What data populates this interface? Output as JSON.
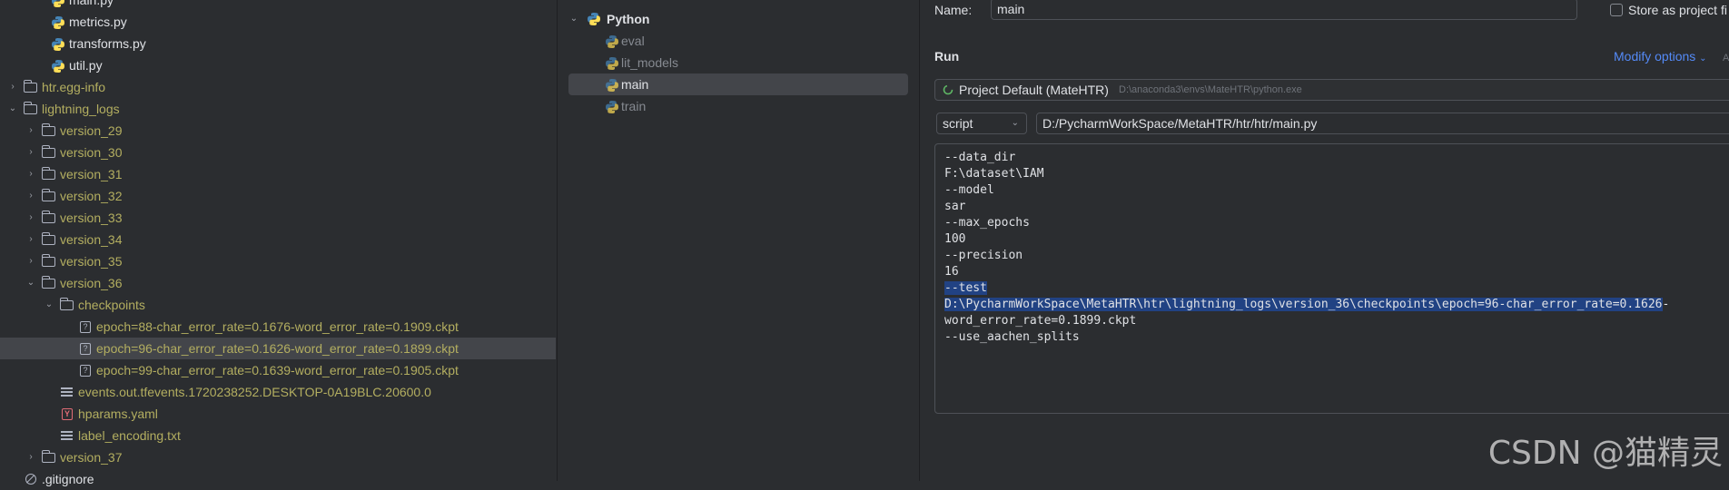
{
  "project_tree": {
    "rows": [
      {
        "label": "main.py",
        "icon": "python-icon",
        "color": "muted"
      },
      {
        "label": "metrics.py",
        "icon": "python-icon",
        "color": "muted"
      },
      {
        "label": "transforms.py",
        "icon": "python-icon",
        "color": "muted"
      },
      {
        "label": "util.py",
        "icon": "python-icon",
        "color": "muted"
      },
      {
        "label": "htr.egg-info",
        "icon": "folder-icon",
        "color": "green",
        "expandable": "collapsed"
      },
      {
        "label": "lightning_logs",
        "icon": "folder-icon",
        "color": "green",
        "expandable": "expanded"
      },
      {
        "label": "version_29",
        "icon": "folder-icon",
        "color": "green",
        "expandable": "collapsed"
      },
      {
        "label": "version_30",
        "icon": "folder-icon",
        "color": "green",
        "expandable": "collapsed"
      },
      {
        "label": "version_31",
        "icon": "folder-icon",
        "color": "green",
        "expandable": "collapsed"
      },
      {
        "label": "version_32",
        "icon": "folder-icon",
        "color": "green",
        "expandable": "collapsed"
      },
      {
        "label": "version_33",
        "icon": "folder-icon",
        "color": "green",
        "expandable": "collapsed"
      },
      {
        "label": "version_34",
        "icon": "folder-icon",
        "color": "green",
        "expandable": "collapsed"
      },
      {
        "label": "version_35",
        "icon": "folder-icon",
        "color": "green",
        "expandable": "collapsed"
      },
      {
        "label": "version_36",
        "icon": "folder-icon",
        "color": "green",
        "expandable": "expanded"
      },
      {
        "label": "checkpoints",
        "icon": "folder-icon",
        "color": "green",
        "expandable": "expanded"
      },
      {
        "label": "epoch=88-char_error_rate=0.1676-word_error_rate=0.1909.ckpt",
        "icon": "unknown-file-icon",
        "color": "green"
      },
      {
        "label": "epoch=96-char_error_rate=0.1626-word_error_rate=0.1899.ckpt",
        "icon": "unknown-file-icon",
        "color": "green",
        "selected": true
      },
      {
        "label": "epoch=99-char_error_rate=0.1639-word_error_rate=0.1905.ckpt",
        "icon": "unknown-file-icon",
        "color": "green"
      },
      {
        "label": "events.out.tfevents.1720238252.DESKTOP-0A19BLC.20600.0",
        "icon": "text-file-icon",
        "color": "green"
      },
      {
        "label": "hparams.yaml",
        "icon": "yaml-icon",
        "color": "green"
      },
      {
        "label": "label_encoding.txt",
        "icon": "text-file-icon",
        "color": "green"
      },
      {
        "label": "version_37",
        "icon": "folder-icon",
        "color": "green",
        "expandable": "collapsed"
      },
      {
        "label": ".gitignore",
        "icon": "ignore-file-icon",
        "color": "muted"
      }
    ]
  },
  "run_configs": {
    "group": "Python",
    "items": [
      "eval",
      "lit_models",
      "main",
      "train"
    ],
    "selected": "main"
  },
  "editor": {
    "name_label": "Name:",
    "name_value": "main",
    "store_label": "Store as project fi",
    "run_section": "Run",
    "modify_options": "Modify options",
    "modify_shortcut": "Al",
    "interpreter_name": "Project Default (MateHTR)",
    "interpreter_path": "D:\\anaconda3\\envs\\MateHTR\\python.exe",
    "target_type": "script",
    "script_path": "D:/PycharmWorkSpace/MetaHTR/htr/htr/main.py",
    "args": [
      {
        "text": "--data_dir",
        "highlighted": false
      },
      {
        "text": "F:\\dataset\\IAM",
        "highlighted": false
      },
      {
        "text": "--model",
        "highlighted": false
      },
      {
        "text": "sar",
        "highlighted": false
      },
      {
        "text": "--max_epochs",
        "highlighted": false
      },
      {
        "text": "100",
        "highlighted": false
      },
      {
        "text": "--precision",
        "highlighted": false
      },
      {
        "text": "16",
        "highlighted": false
      },
      {
        "text": "--test",
        "highlighted": true
      },
      {
        "text": "D:\\PycharmWorkSpace\\MetaHTR\\htr\\lightning_logs\\version_36\\checkpoints\\epoch=96-char_error_rate=0.1626",
        "highlighted": true,
        "suffix": "-"
      },
      {
        "text": "word_error_rate=0.1899.ckpt",
        "highlighted": false
      },
      {
        "text": "--use_aachen_splits",
        "highlighted": false
      }
    ]
  },
  "watermark": "CSDN @猫精灵",
  "colors": {
    "accent": "#548af7",
    "folder_text": "#b3ae60",
    "selection": "#43454a",
    "text_highlight": "#214283"
  }
}
